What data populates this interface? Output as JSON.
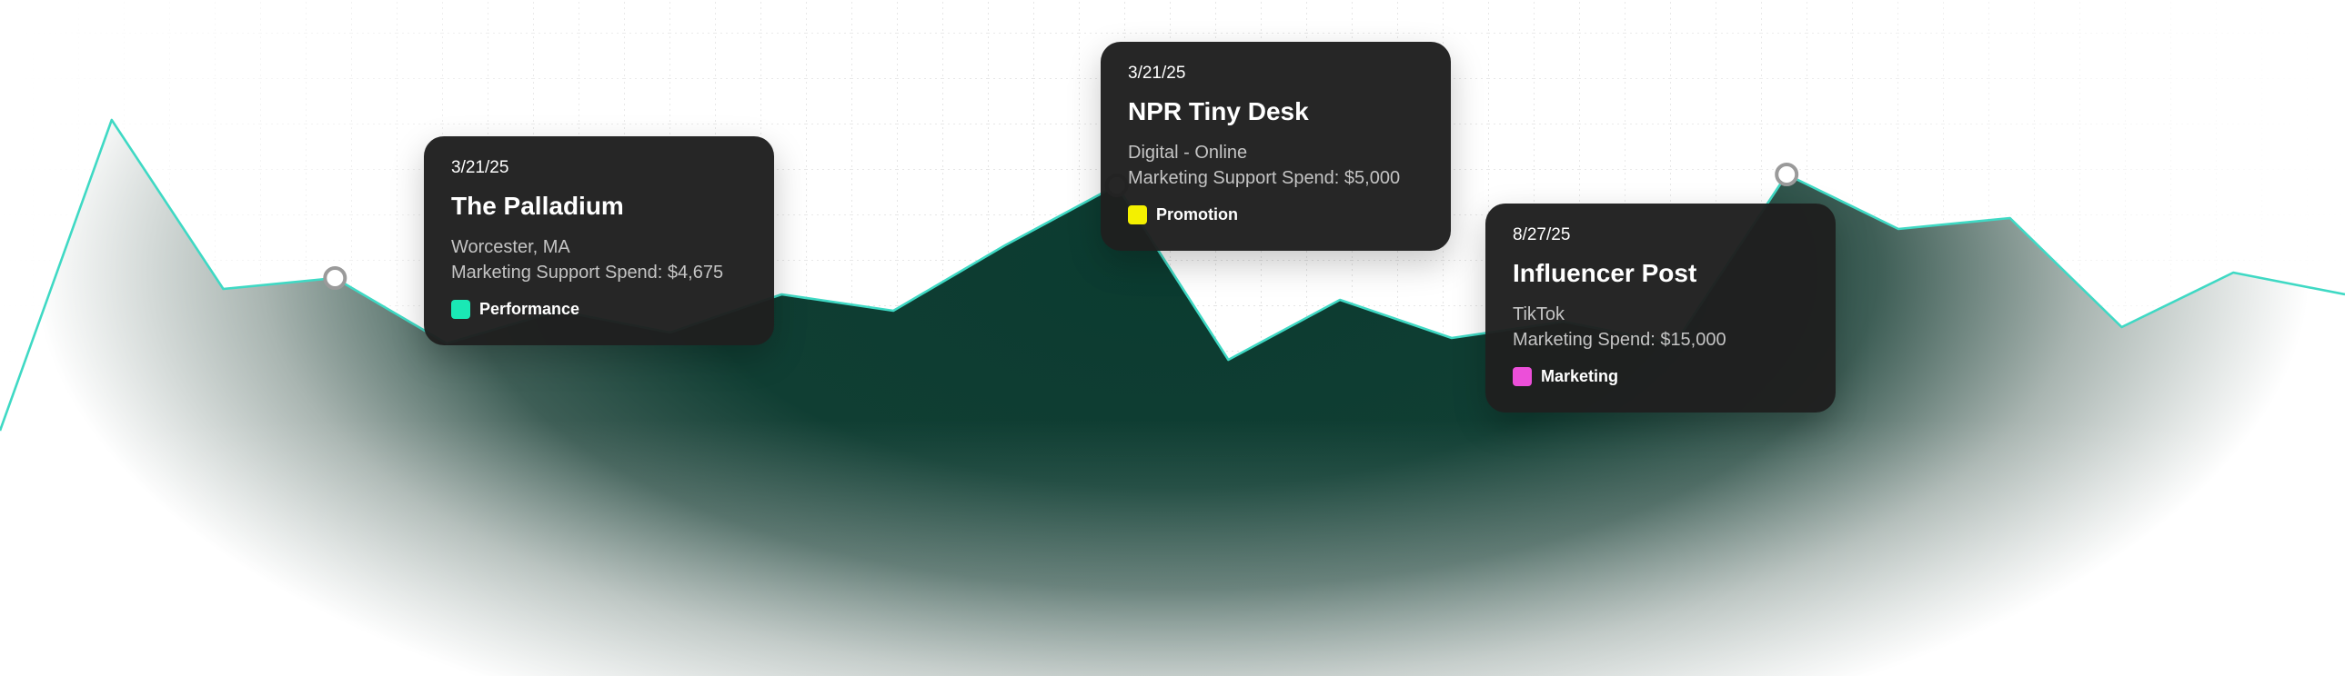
{
  "chart_data": {
    "type": "area",
    "title": "",
    "xlabel": "",
    "ylabel": "",
    "grid": true,
    "legend": "none",
    "ylim": [
      0,
      100
    ],
    "colors": {
      "line": "#3fd9c4",
      "fill_dark": "#0c3a30",
      "marker": "#9a9a9a"
    },
    "series": [
      {
        "values": [
          21,
          78,
          47,
          49,
          37,
          43,
          39,
          46,
          43,
          55,
          66,
          34,
          45,
          38,
          41,
          37,
          68,
          58,
          60,
          40,
          50,
          46
        ],
        "highlight_indices": [
          3,
          10,
          16
        ]
      }
    ],
    "annotations": [
      {
        "date": "3/21/25",
        "title": "The Palladium",
        "location": "Worcester, MA",
        "spend": "Marketing Support Spend: $4,675",
        "tag": "Performance",
        "tag_color": "#1ae8b5"
      },
      {
        "date": "3/21/25",
        "title": "NPR Tiny Desk",
        "location": "Digital - Online",
        "spend": "Marketing Support Spend: $5,000",
        "tag": "Promotion",
        "tag_color": "#f4f000"
      },
      {
        "date": "8/27/25",
        "title": "Influencer Post",
        "location": "TikTok",
        "spend": "Marketing Spend: $15,000",
        "tag": "Marketing",
        "tag_color": "#ec4fd9"
      }
    ]
  }
}
